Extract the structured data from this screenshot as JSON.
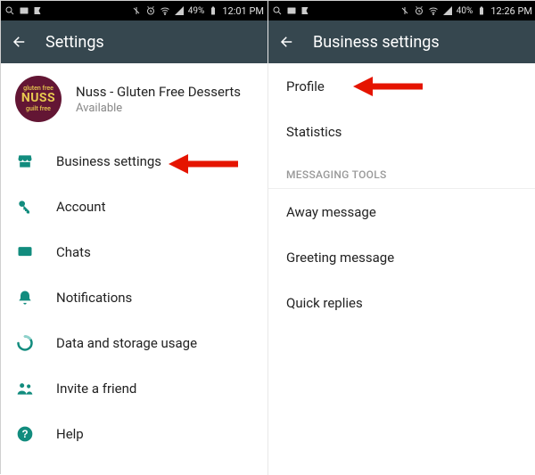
{
  "left": {
    "status": {
      "battery": "49%",
      "time": "12:01 PM"
    },
    "headerTitle": "Settings",
    "profile": {
      "name": "Nuss - Gluten Free Desserts",
      "status": "Available"
    },
    "avatar": {
      "line1": "gluten free",
      "big": "NUSS",
      "line2": "guilt free"
    },
    "items": {
      "business": "Business settings",
      "account": "Account",
      "chats": "Chats",
      "notifications": "Notifications",
      "data": "Data and storage usage",
      "invite": "Invite a friend",
      "help": "Help"
    }
  },
  "right": {
    "status": {
      "battery": "40%",
      "time": "12:26 PM"
    },
    "headerTitle": "Business settings",
    "items": {
      "profile": "Profile",
      "statistics": "Statistics",
      "sectionHeader": "MESSAGING TOOLS",
      "away": "Away message",
      "greeting": "Greeting message",
      "quick": "Quick replies"
    }
  }
}
